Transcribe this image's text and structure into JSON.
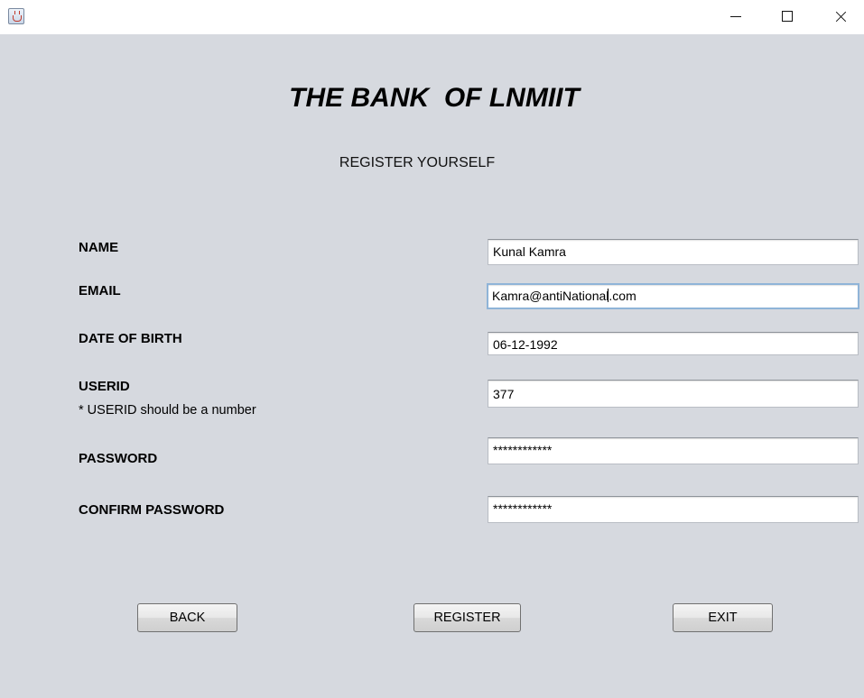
{
  "window": {
    "icon": "java-cup-icon"
  },
  "header": {
    "bank_title": "THE BANK  OF LNMIIT",
    "subtitle": "REGISTER YOURSELF"
  },
  "form": {
    "name_label": "NAME",
    "name_value": "Kunal Kamra",
    "email_label": "EMAIL",
    "email_value_before_caret": "Kamra@antiNational",
    "email_value_after_caret": ".com",
    "dob_label": "DATE OF BIRTH",
    "dob_value": "06-12-1992",
    "userid_label": "USERID",
    "userid_hint": "* USERID should be a number",
    "userid_value": "377",
    "password_label": "PASSWORD",
    "password_value": "************",
    "confirm_password_label": "CONFIRM PASSWORD",
    "confirm_password_value": "************"
  },
  "buttons": {
    "back": "BACK",
    "register": "REGISTER",
    "exit": "EXIT"
  }
}
